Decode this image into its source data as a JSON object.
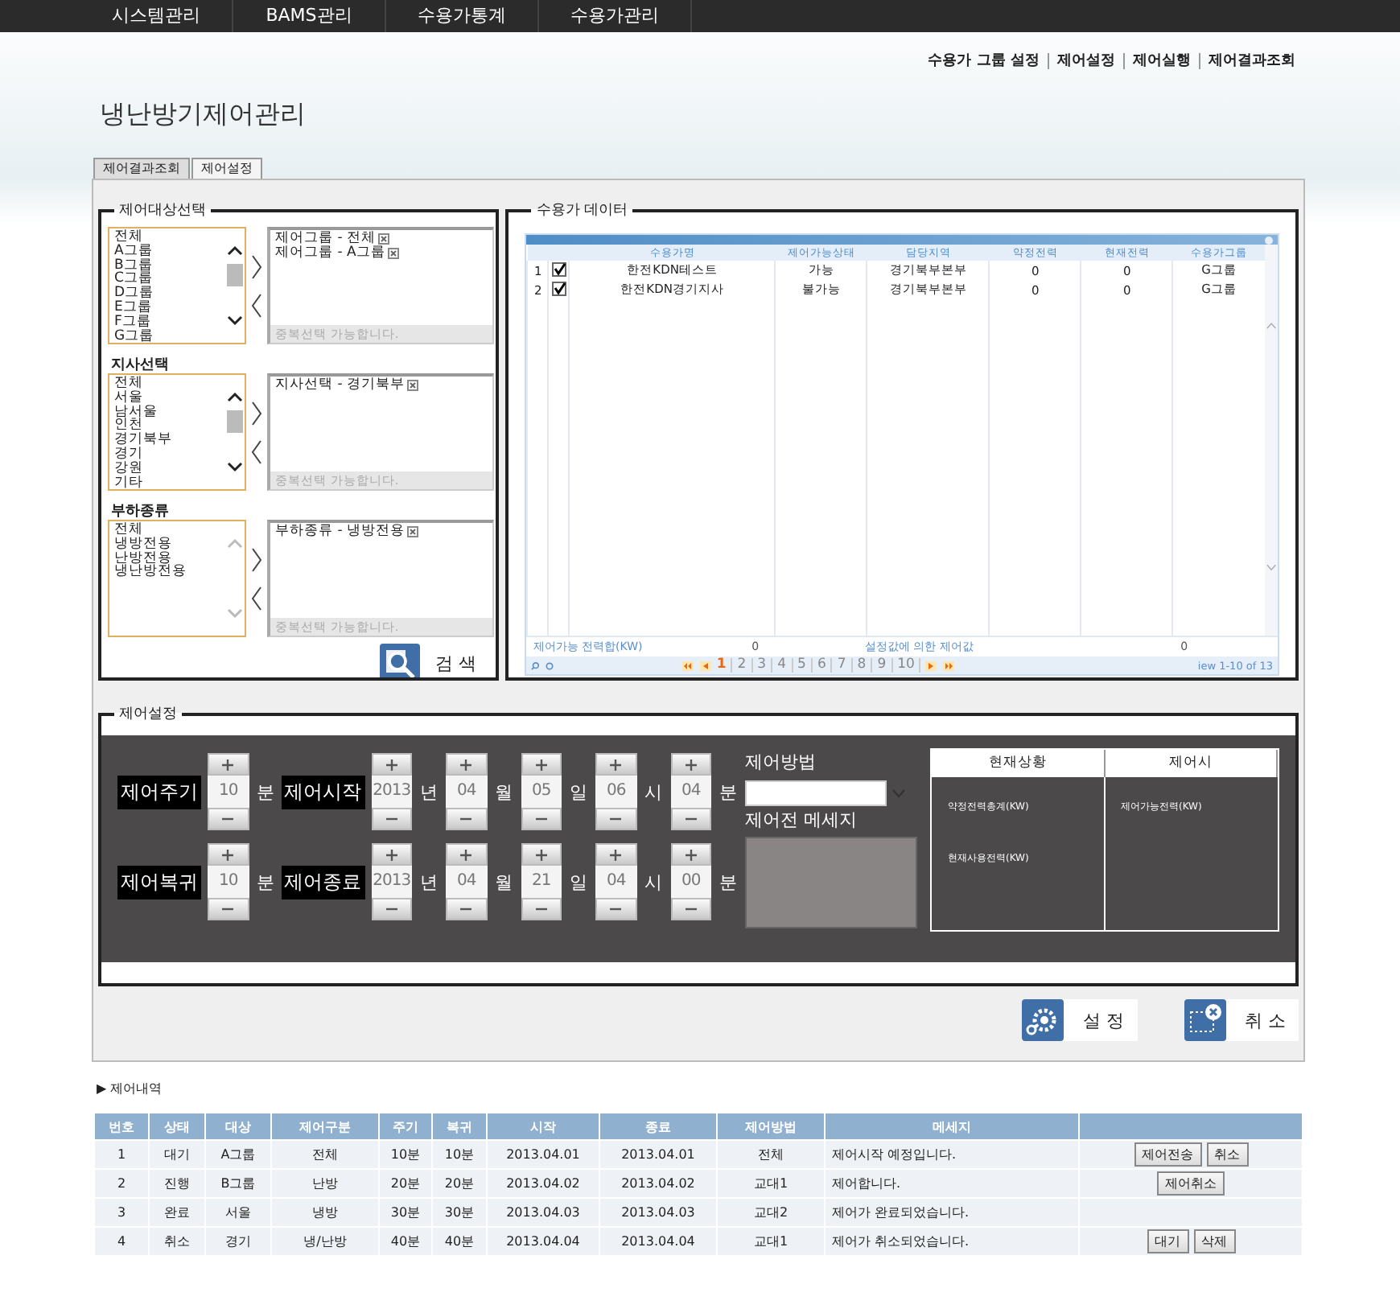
{
  "nav": [
    "시스템관리",
    "BAMS관리",
    "수용가통계",
    "수용가관리"
  ],
  "top_links": [
    "수용가 그룹 설정",
    "제어설정",
    "제어실행",
    "제어결과조회"
  ],
  "page_title": "냉난방기제어관리",
  "tabs": [
    {
      "label": "제어결과조회",
      "selected": false
    },
    {
      "label": "제어설정",
      "selected": true
    }
  ],
  "target_selection": {
    "legend": "제어대상선택",
    "groups": [
      {
        "options": [
          "전체",
          "A그룹",
          "B그룹",
          "C그룹",
          "D그룹",
          "E그룹",
          "F그룹",
          "G그룹"
        ],
        "scrollable": true,
        "chosen": [
          "제어그룹 - 전체",
          "제어그룹 - A그룹"
        ],
        "hint": "중복선택 가능합니다."
      },
      {
        "title": "지사선택",
        "options": [
          "전체",
          "서울",
          "남서울",
          "인천",
          "경기북부",
          "경기",
          "강원",
          "기타"
        ],
        "scrollable": true,
        "chosen": [
          "지사선택 - 경기북부"
        ],
        "hint": "중복선택 가능합니다."
      },
      {
        "title": "부하종류",
        "options": [
          "전체",
          "냉방전용",
          "난방전용",
          "냉난방전용"
        ],
        "scrollable": false,
        "chosen": [
          "부하종류 - 냉방전용"
        ],
        "hint": "중복선택 가능합니다."
      }
    ],
    "search_button": "검 색"
  },
  "customer_data": {
    "legend": "수용가 데이터",
    "columns": [
      "수용가명",
      "제어가능상태",
      "담당지역",
      "약정전력",
      "현재전력",
      "수용가그룹"
    ],
    "rows": [
      {
        "no": "1",
        "checked": true,
        "cells": [
          "한전KDN테스트",
          "가능",
          "경기북부본부",
          "0",
          "0",
          "G그룹"
        ]
      },
      {
        "no": "2",
        "checked": true,
        "cells": [
          "한전KDN경기지사",
          "불가능",
          "경기북부본부",
          "0",
          "0",
          "G그룹"
        ]
      }
    ],
    "footer": [
      "제어가능 전력합(KW)",
      "0",
      "설정값에 의한 제어값",
      "0"
    ],
    "pages": [
      {
        "label": "1",
        "selected": true
      },
      {
        "label": "2",
        "selected": false
      },
      {
        "label": "3",
        "selected": false
      },
      {
        "label": "4",
        "selected": false
      },
      {
        "label": "5",
        "selected": false
      },
      {
        "label": "6",
        "selected": false
      },
      {
        "label": "7",
        "selected": false
      },
      {
        "label": "8",
        "selected": false
      },
      {
        "label": "9",
        "selected": false
      },
      {
        "label": "10",
        "selected": false
      }
    ],
    "page_info": "iew 1-10 of 13"
  },
  "control_settings": {
    "legend": "제어설정",
    "rows": [
      {
        "label": "제어주기",
        "value": "10",
        "unit": "분",
        "range_label": "제어시작",
        "fields": [
          {
            "value": "2013",
            "unit": "년"
          },
          {
            "value": "04",
            "unit": "월"
          },
          {
            "value": "05",
            "unit": "일"
          },
          {
            "value": "06",
            "unit": "시"
          },
          {
            "value": "04",
            "unit": "분"
          }
        ]
      },
      {
        "label": "제어복귀",
        "value": "10",
        "unit": "분",
        "range_label": "제어종료",
        "fields": [
          {
            "value": "2013",
            "unit": "년"
          },
          {
            "value": "04",
            "unit": "월"
          },
          {
            "value": "21",
            "unit": "일"
          },
          {
            "value": "04",
            "unit": "시"
          },
          {
            "value": "00",
            "unit": "분"
          }
        ]
      }
    ],
    "method_label": "제어방법",
    "message_label": "제어전 메세지",
    "status": {
      "headers": [
        "현재상황",
        "제어시"
      ],
      "current": [
        "약정전력총계(KW)",
        "현재사용전력(KW)"
      ],
      "on_control": [
        "제어가능전력(KW)"
      ]
    }
  },
  "action_buttons": [
    {
      "kind": "apply",
      "label": "설 정"
    },
    {
      "kind": "cancel",
      "label": "취 소"
    }
  ],
  "history": {
    "title": "▶ 제어내역",
    "columns": [
      "번호",
      "상태",
      "대상",
      "제어구분",
      "주기",
      "복귀",
      "시작",
      "종료",
      "제어방법",
      "메세지",
      ""
    ],
    "rows": [
      {
        "cells": [
          "1",
          "대기",
          "A그룹",
          "전체",
          "10분",
          "10분",
          "2013.04.01",
          "2013.04.01",
          "전체",
          "제어시작 예정입니다."
        ],
        "actions": [
          "제어전송",
          "취소"
        ]
      },
      {
        "cells": [
          "2",
          "진행",
          "B그룹",
          "난방",
          "20분",
          "20분",
          "2013.04.02",
          "2013.04.02",
          "교대1",
          "제어합니다."
        ],
        "actions": [
          "제어취소"
        ]
      },
      {
        "cells": [
          "3",
          "완료",
          "서울",
          "냉방",
          "30분",
          "30분",
          "2013.04.03",
          "2013.04.03",
          "교대2",
          "제어가 완료되었습니다."
        ],
        "actions": []
      },
      {
        "cells": [
          "4",
          "취소",
          "경기",
          "냉/난방",
          "40분",
          "40분",
          "2013.04.04",
          "2013.04.04",
          "교대1",
          "제어가 취소되었습니다."
        ],
        "actions": [
          "대기",
          "삭제"
        ]
      }
    ]
  }
}
